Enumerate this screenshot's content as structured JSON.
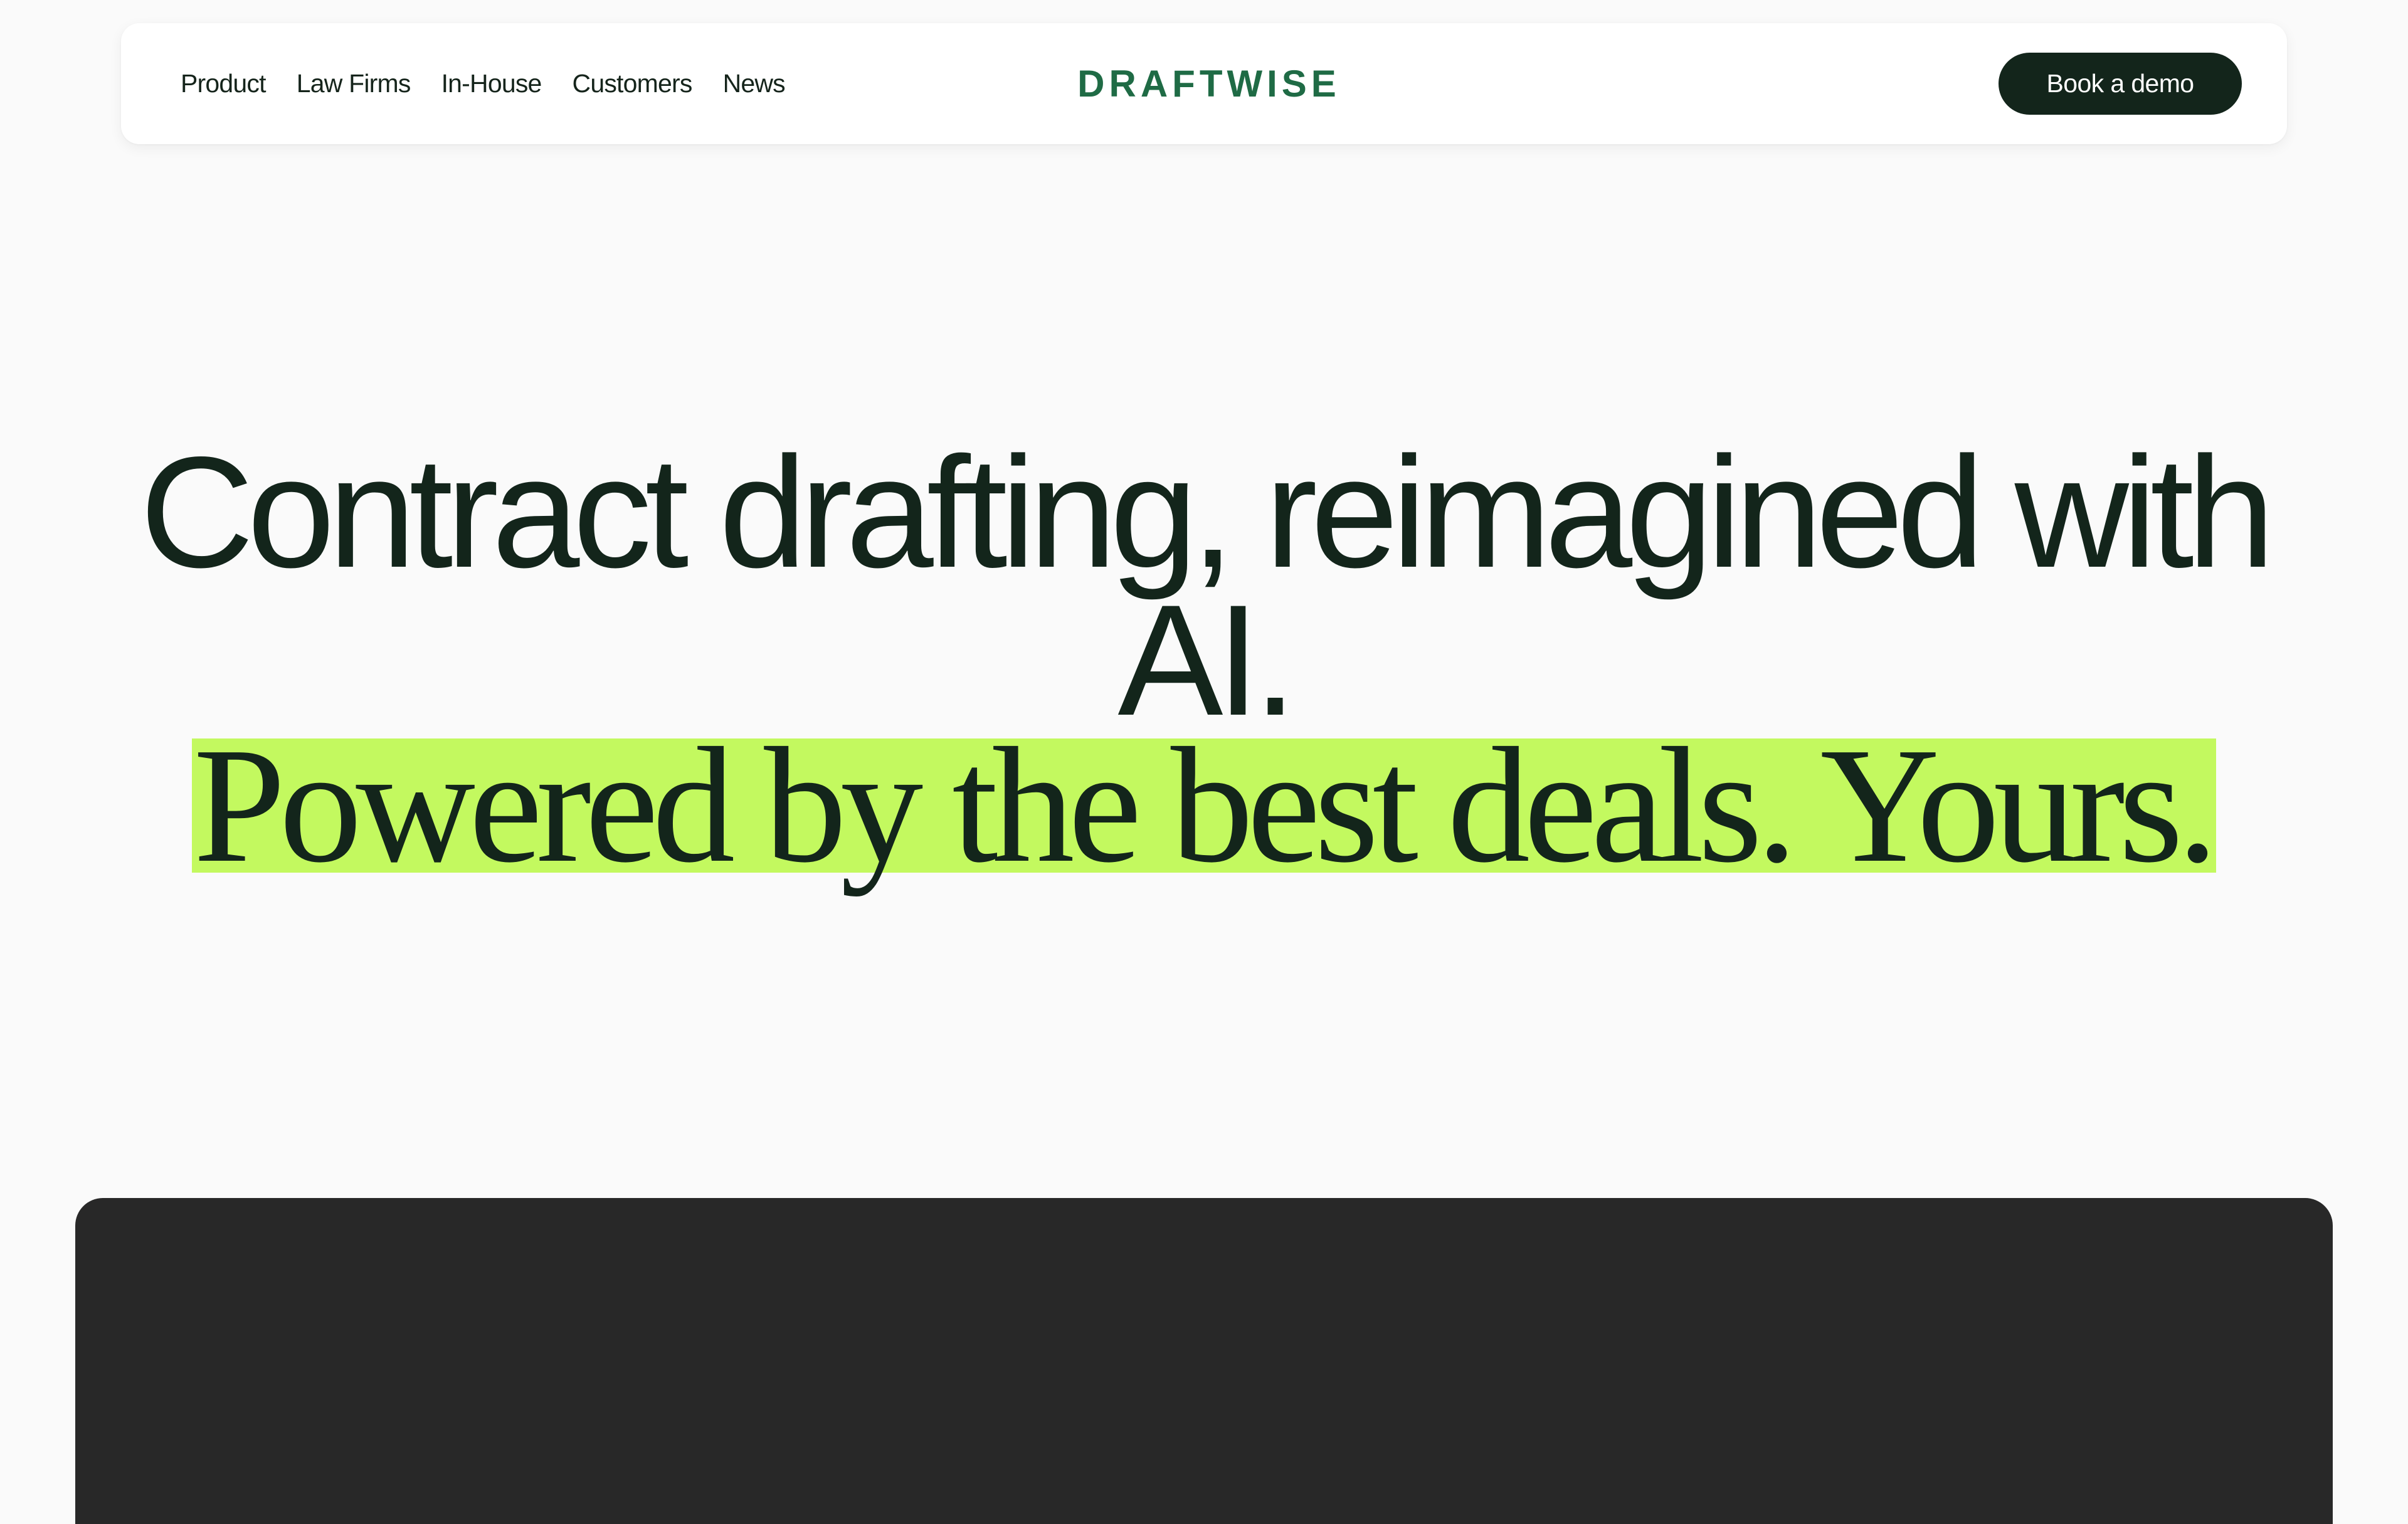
{
  "nav": {
    "links": [
      {
        "label": "Product"
      },
      {
        "label": "Law Firms"
      },
      {
        "label": "In-House"
      },
      {
        "label": "Customers"
      },
      {
        "label": "News"
      }
    ],
    "logo_text": "DRAFTWISE",
    "cta_label": "Book a demo"
  },
  "hero": {
    "title": "Contract drafting, reimagined with AI.",
    "subtitle": "Powered by the best deals. Yours."
  },
  "colors": {
    "background": "#fafafa",
    "text": "#13251b",
    "logo_green": "#1f6b45",
    "highlight": "#c3f95f",
    "panel": "#282828",
    "button": "#13251b"
  }
}
